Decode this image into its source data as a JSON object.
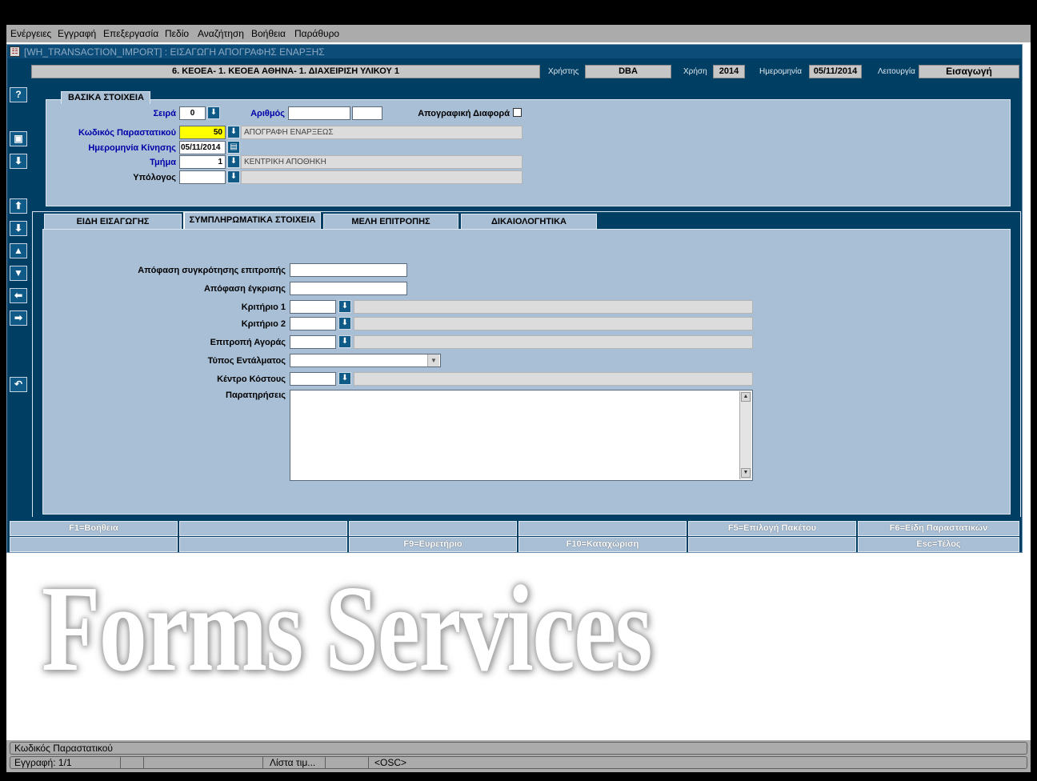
{
  "menu": [
    "Ενέργειες",
    "Εγγραφή",
    "Επεξεργασία",
    "Πεδίο",
    "Αναζήτηση",
    "Βοήθεια",
    "Παράθυρο"
  ],
  "window": {
    "title": "[WH_TRANSACTION_IMPORT] : ΕΙΣΑΓΩΓΗ ΑΠΟΓΡΑΦΗΣ ΕΝΑΡΞΗΣ"
  },
  "header": {
    "org": "6. ΚΕΟΕΑ- 1. ΚΕΟΕΑ ΑΘΗΝΑ- 1. ΔΙΑΧΕΙΡΙΣΗ ΥΛΙΚΟΥ 1",
    "user_label": "Χρήστης",
    "user": "DBA",
    "year_label": "Χρήση",
    "year": "2014",
    "date_label": "Ημερομηνία",
    "date": "05/11/2014",
    "mode_label": "Λειτουργία",
    "mode": "Εισαγωγή"
  },
  "toolbar": [
    "help-icon",
    "save-icon",
    "download-icon",
    "first-record-icon",
    "last-record-icon",
    "previous-record-icon",
    "next-record-icon",
    "previous-block-icon",
    "next-block-icon",
    "undo-icon"
  ],
  "basic": {
    "legend": "ΒΑΣΙΚΑ ΣΤΟΙΧΕΙΑ",
    "series_label": "Σειρά",
    "series_value": "0",
    "number_label": "Αριθμός",
    "number_value": "",
    "number_value2": "",
    "inventory_diff_label": "Απογραφική Διαφορά",
    "inventory_diff_checked": false,
    "doc_code_label": "Κωδικός Παραστατικού",
    "doc_code_value": "50",
    "doc_code_desc": "ΑΠΟΓΡΑΦΗ ΕΝΑΡΞΕΩΣ",
    "move_date_label": "Ημερομηνία Κίνησης",
    "move_date_value": "05/11/2014",
    "dept_label": "Τμήμα",
    "dept_value": "1",
    "dept_desc": "ΚΕΝΤΡΙΚΗ ΑΠΟΘΗΚΗ",
    "accountable_label": "Υπόλογος",
    "accountable_value": "",
    "accountable_desc": ""
  },
  "tabs": [
    {
      "label": "ΕΙΔΗ ΕΙΣΑΓΩΓΗΣ",
      "active": false
    },
    {
      "label": "ΣΥΜΠΛΗΡΩΜΑΤΙΚΑ ΣΤΟΙΧΕΙΑ",
      "active": true
    },
    {
      "label": "ΜΕΛΗ ΕΠΙΤΡΟΠΗΣ",
      "active": false
    },
    {
      "label": "ΔΙΚΑΙΟΛΟΓΗΤΙΚΑ",
      "active": false
    }
  ],
  "extra": {
    "committee_decision_label": "Απόφαση συγκρότησης επιτροπής",
    "committee_decision_value": "",
    "approval_decision_label": "Απόφαση έγκρισης",
    "approval_decision_value": "",
    "criterion1_label": "Κριτήριο 1",
    "criterion1_value": "",
    "criterion1_desc": "",
    "criterion2_label": "Κριτήριο 2",
    "criterion2_value": "",
    "criterion2_desc": "",
    "purchase_committee_label": "Επιτροπή Αγοράς",
    "purchase_committee_value": "",
    "purchase_committee_desc": "",
    "warrant_type_label": "Τύπος Εντάλματος",
    "warrant_type_value": "",
    "cost_center_label": "Κέντρο Κόστους",
    "cost_center_value": "",
    "cost_center_desc": "",
    "notes_label": "Παρατηρήσεις",
    "notes_value": ""
  },
  "keys_row1": [
    "F1=Βοήθεια",
    "",
    "",
    "",
    "F5=Επιλογή Πακέτου",
    "F6=Είδη Παραστατικών"
  ],
  "keys_row2": [
    "",
    "",
    "F9=Ευρετήριο",
    "F10=Καταχώριση",
    "",
    "Esc=Τέλος"
  ],
  "watermark": "Forms Services",
  "status": {
    "hint": "Κωδικός Παραστατικού",
    "record": "Εγγραφή: 1/1",
    "list": "Λίστα τιμ...",
    "osc": "<OSC>"
  }
}
